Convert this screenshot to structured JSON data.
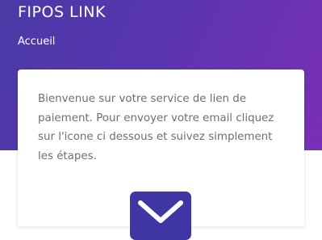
{
  "header": {
    "title": "FIPOS LINK",
    "breadcrumb": "Accueil"
  },
  "card": {
    "welcome_text": "Bienvenue sur votre service de lien de paiement. Pour envoyer votre email cliquez sur l'icone ci dessous et suivez simplement les étapes.",
    "email_icon": "envelope-icon"
  },
  "colors": {
    "header_gradient_start": "#4a3aa6",
    "header_gradient_end": "#7a2fb5",
    "button": "#3f36a4",
    "text": "#6e6e6e"
  }
}
